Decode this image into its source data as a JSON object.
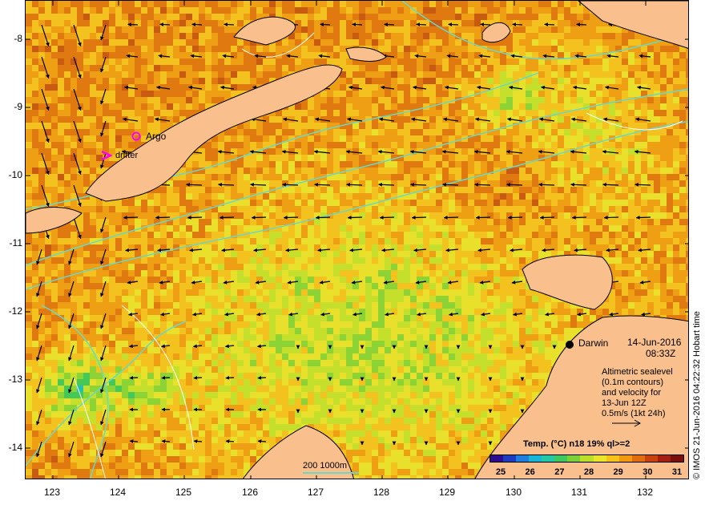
{
  "axes": {
    "latitudes": [
      "-8",
      "-9",
      "-10",
      "-11",
      "-12",
      "-13",
      "-14"
    ],
    "longitudes": [
      "123",
      "124",
      "125",
      "126",
      "127",
      "128",
      "129",
      "130",
      "131",
      "132"
    ]
  },
  "labels": {
    "argo": "Argo",
    "drifter": "drifter",
    "darwin": "Darwin",
    "date": "14-Jun-2016",
    "time": "08:33Z",
    "altimetry_lines": [
      "Altimetric sealevel",
      "(0.1m contours)",
      "and velocity for",
      "13-Jun 12Z",
      "0.5m/s (1kt 24h)"
    ],
    "depth_legend": "200  1000m",
    "credit": "© IMOS 21-Jun-2016 04:22:32 Hobart time"
  },
  "colorbar": {
    "title": "Temp. (°C) n18 19% ql>=2",
    "ticks": [
      "25",
      "26",
      "27",
      "28",
      "29",
      "30",
      "31"
    ],
    "colors": [
      "#2a0e8f",
      "#1d3cc4",
      "#1f7fe0",
      "#19b5d8",
      "#24c8a8",
      "#3fc860",
      "#7bd13a",
      "#b9e02a",
      "#e8e62a",
      "#f5c41c",
      "#f09a12",
      "#e06d10",
      "#c84210",
      "#a51f12",
      "#7a0f10"
    ]
  },
  "style": {
    "land": "#f9c08e",
    "coast": "#000000",
    "contour": "#69d9c6",
    "argo_marker": "#ff00ff",
    "drifter_marker": "#ff00ff"
  }
}
